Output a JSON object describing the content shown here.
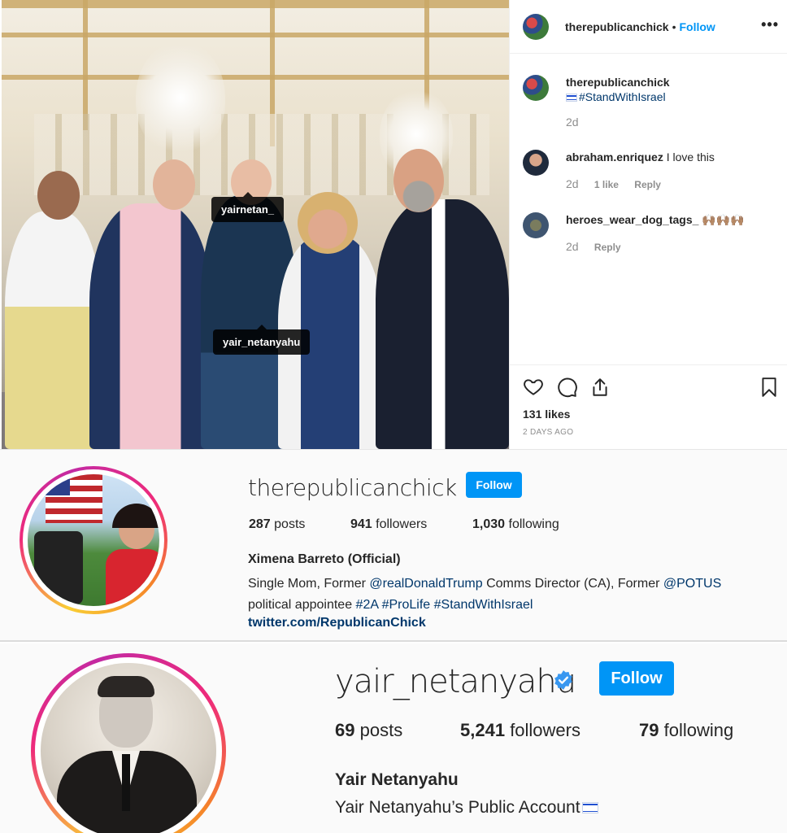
{
  "post": {
    "photo_tags": [
      "yairnetan_",
      "yair_netanyahu"
    ],
    "header": {
      "username": "therepublicanchick",
      "separator": "•",
      "follow_label": "Follow",
      "more_label": "•••"
    },
    "comments": [
      {
        "username": "therepublicanchick",
        "text": "#StandWithIsrael",
        "time": "2d"
      },
      {
        "username": "abraham.enriquez",
        "text": "I love this",
        "time": "2d",
        "likes": "1 like",
        "reply_label": "Reply"
      },
      {
        "username": "heroes_wear_dog_tags_",
        "text": "🙌🏽🙌🏽🙌🏽",
        "time": "2d",
        "reply_label": "Reply"
      }
    ],
    "likes": "131 likes",
    "time_ago": "2 DAYS AGO",
    "icons": [
      "heart-icon",
      "comment-icon",
      "share-icon",
      "bookmark-icon"
    ]
  },
  "profile1": {
    "username": "therepublicanchick",
    "follow_label": "Follow",
    "posts_count": "287",
    "posts_label": "posts",
    "followers_count": "941",
    "followers_label": "followers",
    "following_count": "1,030",
    "following_label": "following",
    "full_name": "Ximena Barreto (Official)",
    "bio": {
      "t1": "Single Mom, Former ",
      "m1": "@realDonaldTrump",
      "t2": " Comms Director (CA), Former ",
      "m2": "@POTUS",
      "t3": "political appointee ",
      "h1": "#2A",
      "h2": "#ProLife",
      "h3": "#StandWithIsrael"
    },
    "link": "twitter.com/RepublicanChick"
  },
  "profile2": {
    "username": "yair_netanyahu",
    "follow_label": "Follow",
    "posts_count": "69",
    "posts_label": "posts",
    "followers_count": "5,241",
    "followers_label": "followers",
    "following_count": "79",
    "following_label": "following",
    "full_name": "Yair Netanyahu",
    "bio": "Yair Netanyahu’s Public Account"
  },
  "colors": {
    "accent": "#0095f6",
    "link": "#00376b",
    "muted": "#8e8e8e"
  }
}
